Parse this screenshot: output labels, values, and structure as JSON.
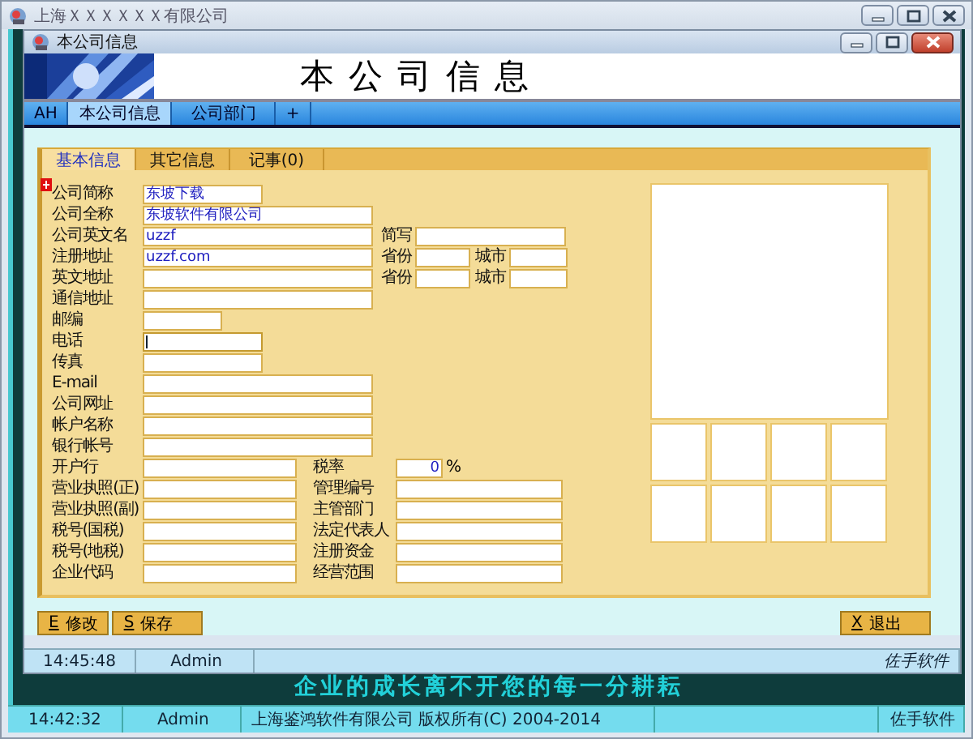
{
  "window": {
    "title": "上海ＸＸＸＸＸＸ有限公司"
  },
  "background_slogan": "企业的成长离不开您的每一分耕耘",
  "company_window": {
    "title": "本公司信息",
    "banner_title": "本公司信息",
    "tabs": [
      {
        "label": "AH",
        "selected": false
      },
      {
        "label": "本公司信息",
        "selected": true
      },
      {
        "label": "公司部门",
        "selected": false
      },
      {
        "label": "+",
        "selected": false
      }
    ],
    "form_tabs": [
      {
        "label": "基本信息",
        "selected": true
      },
      {
        "label": "其它信息",
        "selected": false
      },
      {
        "label": "记事(0)",
        "selected": false
      }
    ],
    "rows": [
      {
        "label": "公司简称",
        "value": "东坡下载",
        "focused": false
      },
      {
        "label": "公司全称",
        "value": "东坡软件有限公司",
        "focused": false
      },
      {
        "label": "公司英文名",
        "value": "uzzf",
        "focused": false,
        "extra": [
          {
            "kind": "text",
            "label": "简写"
          }
        ]
      },
      {
        "label": "注册地址",
        "value": "uzzf.com",
        "focused": false,
        "extra": [
          {
            "kind": "text",
            "label": "省份"
          },
          {
            "kind": "text",
            "label": "城市"
          }
        ]
      },
      {
        "label": "英文地址",
        "focused": false,
        "extra": [
          {
            "kind": "text",
            "label": "省份"
          },
          {
            "kind": "text",
            "label": "城市"
          }
        ]
      },
      {
        "label": "通信地址",
        "focused": false
      },
      {
        "label": "邮编",
        "focused": false
      },
      {
        "label": "电话",
        "focused": true
      },
      {
        "label": "传真",
        "focused": false
      },
      {
        "label": "E-mail",
        "focused": false
      },
      {
        "label": "公司网址",
        "focused": false
      },
      {
        "label": "帐户名称",
        "focused": false
      },
      {
        "label": "银行帐号",
        "focused": false
      },
      {
        "label": "开户行",
        "focused": false,
        "extra": [
          {
            "kind": "number",
            "label": "税率",
            "value": "0",
            "unit": "%"
          }
        ]
      },
      {
        "label": "营业执照(正)",
        "focused": false,
        "extra": [
          {
            "kind": "text",
            "label": "管理编号"
          }
        ]
      },
      {
        "label": "营业执照(副)",
        "focused": false,
        "extra": [
          {
            "kind": "text",
            "label": "主管部门"
          }
        ]
      },
      {
        "label": "税号(国税)",
        "focused": false,
        "extra": [
          {
            "kind": "text",
            "label": "法定代表人"
          }
        ]
      },
      {
        "label": "税号(地税)",
        "focused": false,
        "extra": [
          {
            "kind": "text",
            "label": "注册资金"
          }
        ]
      },
      {
        "label": "企业代码",
        "focused": false,
        "extra": [
          {
            "kind": "text",
            "label": "经营范围"
          }
        ]
      }
    ],
    "buttons": [
      {
        "key": "E",
        "label": "修改"
      },
      {
        "key": "S",
        "label": "保存"
      },
      {
        "key": "X",
        "label": "退出"
      }
    ],
    "status_bar": {
      "time": "14:45:48",
      "user": "Admin",
      "brand": "佐手软件"
    }
  },
  "status_bar": {
    "time": "14:42:32",
    "user": "Admin",
    "copyright": "上海鉴鸿软件有限公司 版权所有(C) 2004-2014",
    "brand": "佐手软件"
  }
}
